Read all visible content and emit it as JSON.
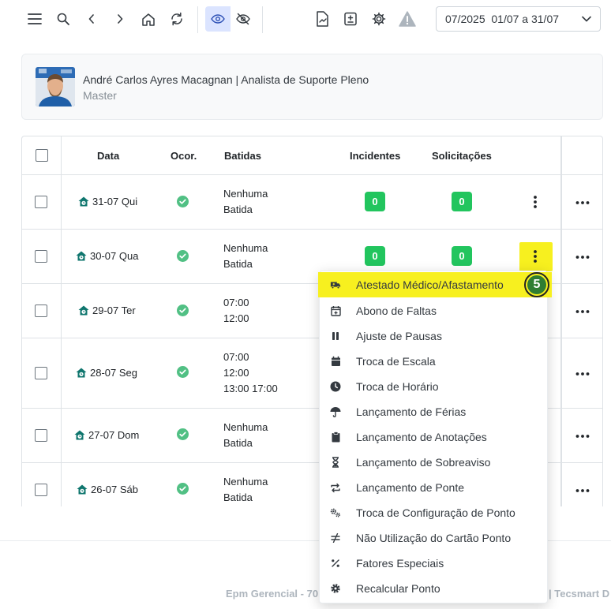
{
  "toolbar": {
    "icons": [
      "menu-icon",
      "search-icon",
      "chevron-left-icon",
      "chevron-right-icon",
      "home-icon",
      "refresh-icon",
      "eye-icon",
      "eye-off-icon",
      "document-chart-icon",
      "calculator-icon",
      "gear-icon",
      "warning-icon"
    ],
    "period": "07/2025  01/07 a 31/07"
  },
  "user": {
    "name": "André Carlos Ayres Macagnan | Analista de Suporte Pleno",
    "role": "Master"
  },
  "table": {
    "headers": {
      "date": "Data",
      "occurrence": "Ocor.",
      "punches": "Batidas",
      "incidents": "Incidentes",
      "requests": "Solicitações"
    },
    "rows": [
      {
        "date": "31-07 Qui",
        "punches": [
          "Nenhuma",
          "Batida"
        ],
        "incidents": "0",
        "requests": "0"
      },
      {
        "date": "30-07 Qua",
        "punches": [
          "Nenhuma",
          "Batida"
        ],
        "incidents": "0",
        "requests": "0"
      },
      {
        "date": "29-07 Ter",
        "punches": [
          "07:00",
          "12:00"
        ],
        "incidents": "",
        "requests": ""
      },
      {
        "date": "28-07 Seg",
        "punches": [
          "07:00",
          "12:00",
          "13:00 17:00"
        ],
        "incidents": "",
        "requests": ""
      },
      {
        "date": "27-07 Dom",
        "punches": [
          "Nenhuma",
          "Batida"
        ],
        "incidents": "",
        "requests": ""
      },
      {
        "date": "26-07 Sáb",
        "punches": [
          "Nenhuma",
          "Batida"
        ],
        "incidents": "",
        "requests": ""
      }
    ]
  },
  "menu": {
    "items": [
      {
        "label": "Atestado Médico/Afastamento",
        "icon": "ambulance-icon"
      },
      {
        "label": "Abono de Faltas",
        "icon": "calendar-plus-icon"
      },
      {
        "label": "Ajuste de Pausas",
        "icon": "pause-icon"
      },
      {
        "label": "Troca de Escala",
        "icon": "calendar-icon"
      },
      {
        "label": "Troca de Horário",
        "icon": "clock-icon"
      },
      {
        "label": "Lançamento de Férias",
        "icon": "umbrella-icon"
      },
      {
        "label": "Lançamento de Anotações",
        "icon": "clipboard-icon"
      },
      {
        "label": "Lançamento de Sobreaviso",
        "icon": "hourglass-icon"
      },
      {
        "label": "Lançamento de Ponte",
        "icon": "repeat-icon"
      },
      {
        "label": "Troca de Configuração de Ponto",
        "icon": "cogs-icon"
      },
      {
        "label": "Não Utilização do Cartão Ponto",
        "icon": "not-equal-icon"
      },
      {
        "label": "Fatores Especiais",
        "icon": "percent-icon"
      },
      {
        "label": "Recalcular Ponto",
        "icon": "gear-icon"
      }
    ]
  },
  "step_marker": "5",
  "footer": {
    "left": "Epm Gerencial - 70",
    "right": "| Tecsmart D"
  },
  "colors": {
    "badge_green": "#22c55e",
    "highlight_yellow": "#f7f01f",
    "accent_teal": "#0f766e"
  }
}
